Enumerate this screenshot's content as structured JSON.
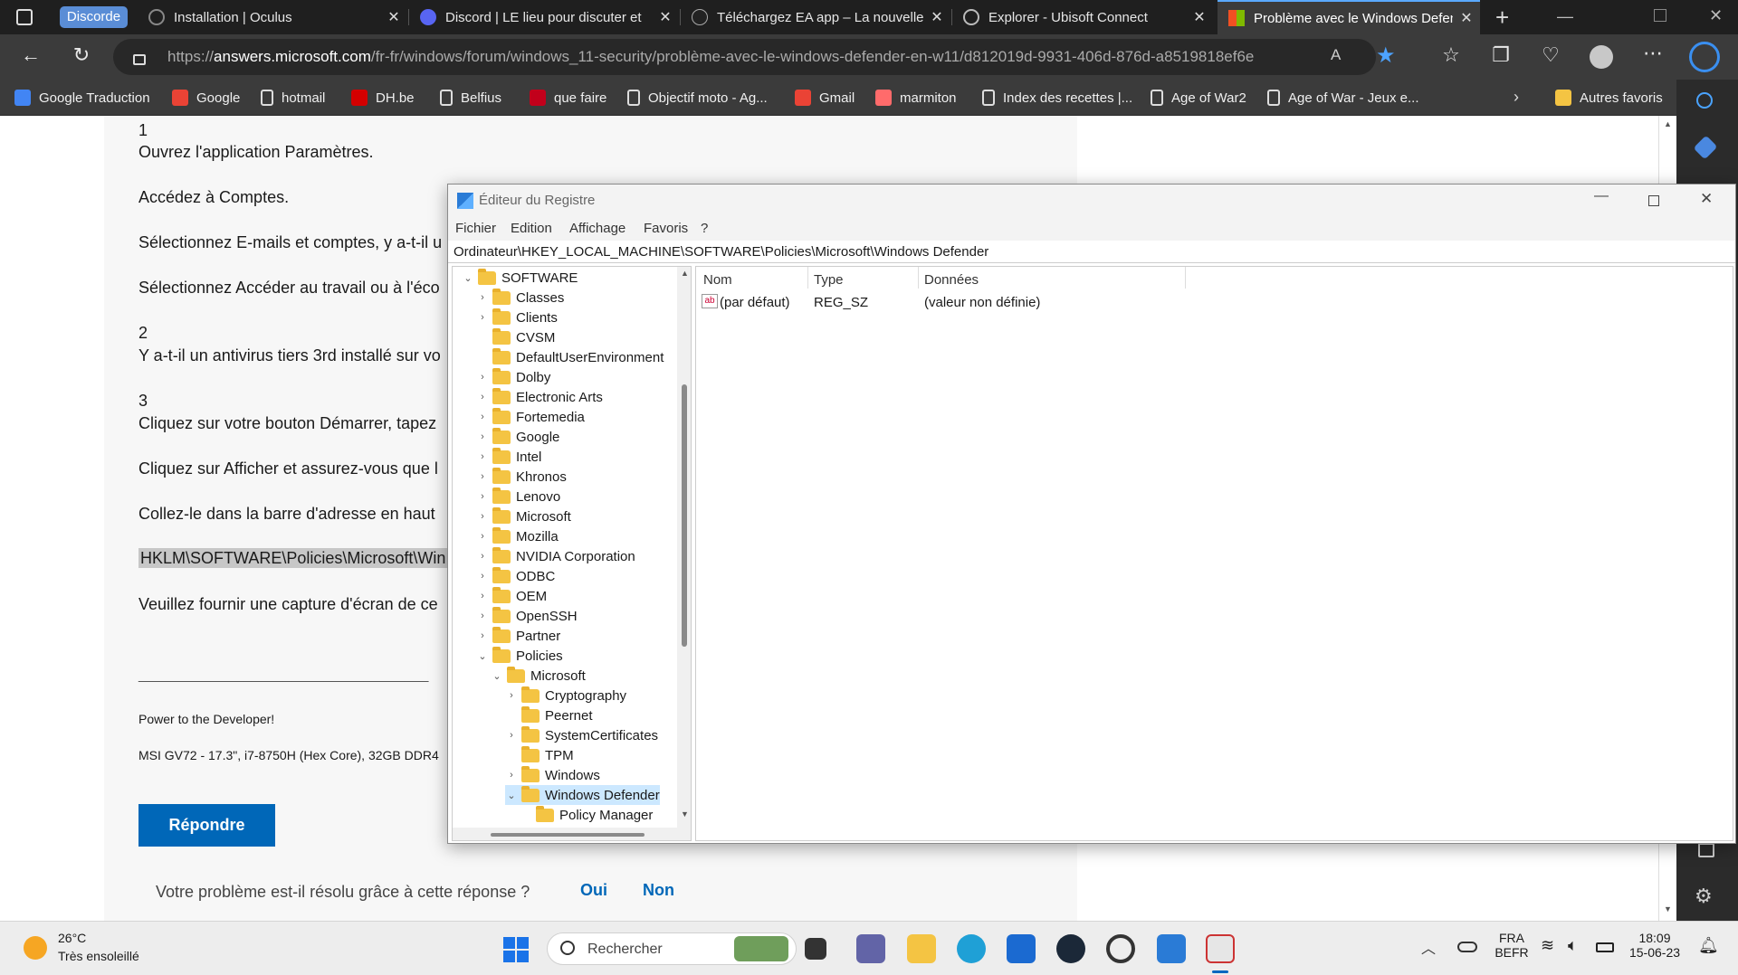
{
  "browser": {
    "tabs": [
      {
        "label": "Discorde",
        "group": true
      },
      {
        "label": "Installation | Oculus"
      },
      {
        "label": "Discord | LE lieu pour discuter et"
      },
      {
        "label": "Téléchargez EA app – La nouvelle"
      },
      {
        "label": "Explorer - Ubisoft Connect"
      },
      {
        "label": "Problème avec le Windows Defen",
        "active": true
      }
    ],
    "url_prefix": "https://",
    "url_domain": "answers.microsoft.com",
    "url_path": "/fr-fr/windows/forum/windows_11-security/problème-avec-le-windows-defender-en-w11/d812019d-9931-406d-876d-a8519818ef6e",
    "bookmarks": [
      {
        "label": "Google Traduction",
        "color": "#4285f4"
      },
      {
        "label": "Google",
        "color": "#ea4335"
      },
      {
        "label": "hotmail",
        "color": "#ffffff"
      },
      {
        "label": "DH.be",
        "color": "#d40000"
      },
      {
        "label": "Belfius",
        "color": "#ffffff"
      },
      {
        "label": "que faire",
        "color": "#c2001b"
      },
      {
        "label": "Objectif moto - Ag...",
        "color": "#ffffff"
      },
      {
        "label": "Gmail",
        "color": "#ea4335"
      },
      {
        "label": "marmiton",
        "color": "#ff6b6b"
      },
      {
        "label": "Index des recettes |...",
        "color": "#ffffff"
      },
      {
        "label": "Age of War2",
        "color": "#ffffff"
      },
      {
        "label": "Age of War - Jeux e...",
        "color": "#ffffff"
      }
    ],
    "other_favorites": "Autres favoris"
  },
  "page": {
    "lines": [
      "1",
      "Ouvrez l'application Paramètres.",
      "Accédez à Comptes.",
      "Sélectionnez E-mails et comptes, y a-t-il u",
      "Sélectionnez Accéder au travail ou à l'éco",
      "2",
      "Y a-t-il un antivirus tiers 3rd installé sur vo",
      "3",
      "Cliquez sur votre bouton Démarrer, tapez",
      "Cliquez sur Afficher et assurez-vous que l",
      "Collez-le dans la barre d'adresse en haut",
      "HKLM\\SOFTWARE\\Policies\\Microsoft\\Win",
      "Veuillez fournir une capture d'écran de ce"
    ],
    "signature_line": "____________________________________",
    "signature": "Power to the Developer!",
    "machine": "MSI GV72 - 17.3\", i7-8750H (Hex Core), 32GB DDR4",
    "reply_button": "Répondre",
    "resolved_question": "Votre problème est-il résolu grâce à cette réponse ?",
    "yes": "Oui",
    "no": "Non"
  },
  "regedit": {
    "title": "Éditeur du Registre",
    "menu": [
      "Fichier",
      "Edition",
      "Affichage",
      "Favoris",
      "?"
    ],
    "path": "Ordinateur\\HKEY_LOCAL_MACHINE\\SOFTWARE\\Policies\\Microsoft\\Windows Defender",
    "tree": [
      {
        "label": "SOFTWARE",
        "level": 0,
        "expanded": true
      },
      {
        "label": "Classes",
        "level": 1,
        "caret": true
      },
      {
        "label": "Clients",
        "level": 1,
        "caret": true
      },
      {
        "label": "CVSM",
        "level": 1
      },
      {
        "label": "DefaultUserEnvironment",
        "level": 1
      },
      {
        "label": "Dolby",
        "level": 1,
        "caret": true
      },
      {
        "label": "Electronic Arts",
        "level": 1,
        "caret": true
      },
      {
        "label": "Fortemedia",
        "level": 1,
        "caret": true
      },
      {
        "label": "Google",
        "level": 1,
        "caret": true
      },
      {
        "label": "Intel",
        "level": 1,
        "caret": true
      },
      {
        "label": "Khronos",
        "level": 1,
        "caret": true
      },
      {
        "label": "Lenovo",
        "level": 1,
        "caret": true
      },
      {
        "label": "Microsoft",
        "level": 1,
        "caret": true
      },
      {
        "label": "Mozilla",
        "level": 1,
        "caret": true
      },
      {
        "label": "NVIDIA Corporation",
        "level": 1,
        "caret": true
      },
      {
        "label": "ODBC",
        "level": 1,
        "caret": true
      },
      {
        "label": "OEM",
        "level": 1,
        "caret": true
      },
      {
        "label": "OpenSSH",
        "level": 1,
        "caret": true
      },
      {
        "label": "Partner",
        "level": 1,
        "caret": true
      },
      {
        "label": "Policies",
        "level": 1,
        "expanded": true
      },
      {
        "label": "Microsoft",
        "level": 2,
        "expanded": true
      },
      {
        "label": "Cryptography",
        "level": 3,
        "caret": true
      },
      {
        "label": "Peernet",
        "level": 3
      },
      {
        "label": "SystemCertificates",
        "level": 3,
        "caret": true
      },
      {
        "label": "TPM",
        "level": 3
      },
      {
        "label": "Windows",
        "level": 3,
        "caret": true
      },
      {
        "label": "Windows Defender",
        "level": 3,
        "expanded": true,
        "selected": true
      },
      {
        "label": "Policy Manager",
        "level": 4
      }
    ],
    "columns": [
      "Nom",
      "Type",
      "Données"
    ],
    "values": [
      {
        "name": "(par défaut)",
        "type": "REG_SZ",
        "data": "(valeur non définie)"
      }
    ]
  },
  "taskbar": {
    "weather_temp": "26°C",
    "weather_desc": "Très ensoleillé",
    "search_placeholder": "Rechercher",
    "lang_top": "FRA",
    "lang_bottom": "BEFR",
    "time": "18:09",
    "date": "15-06-23"
  }
}
